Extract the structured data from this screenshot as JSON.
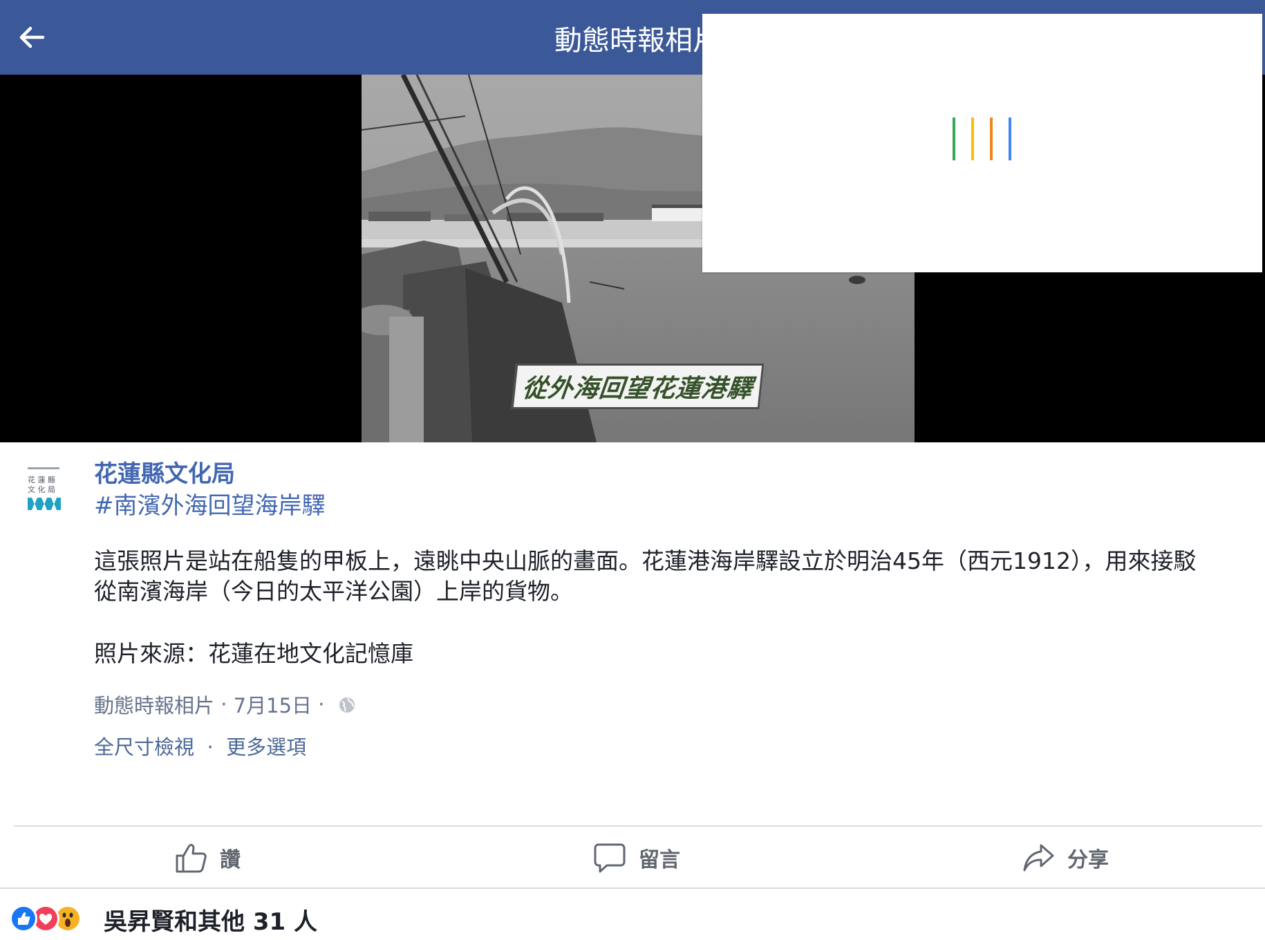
{
  "header": {
    "title": "動態時報相片"
  },
  "photo": {
    "caption": "從外海回望花蓮港驛"
  },
  "loader": {
    "colors": [
      "#34a853",
      "#fbbc05",
      "#ea8a1a",
      "#4285f4"
    ]
  },
  "post": {
    "avatar_text": "花蓮縣\n文化局",
    "page_name": "花蓮縣文化局",
    "hashtag": "#南濱外海回望海岸驛",
    "body_line1": "這張照片是站在船隻的甲板上，遠眺中央山脈的畫面。花蓮港海岸驛設立於明治45年（西元1912），用來接駁",
    "body_line2": "從南濱海岸（今日的太平洋公園）上岸的貨物。",
    "source_line": "照片來源：花蓮在地文化記憶庫",
    "meta": {
      "album": "動態時報相片",
      "separator": " · ",
      "date": "7月15日",
      "privacy_icon": "globe-icon"
    },
    "options": {
      "full_size": "全尺寸檢視",
      "separator": " · ",
      "more": "更多選項"
    }
  },
  "actions": {
    "like": "讚",
    "comment": "留言",
    "share": "分享"
  },
  "reactions": {
    "icons": [
      "like-icon",
      "love-icon",
      "wow-icon"
    ],
    "summary": "吳昇賢和其他 31 人"
  },
  "colors": {
    "header_bg": "#3b5998",
    "link_blue": "#4267b2",
    "meta_gray": "#65738c"
  }
}
